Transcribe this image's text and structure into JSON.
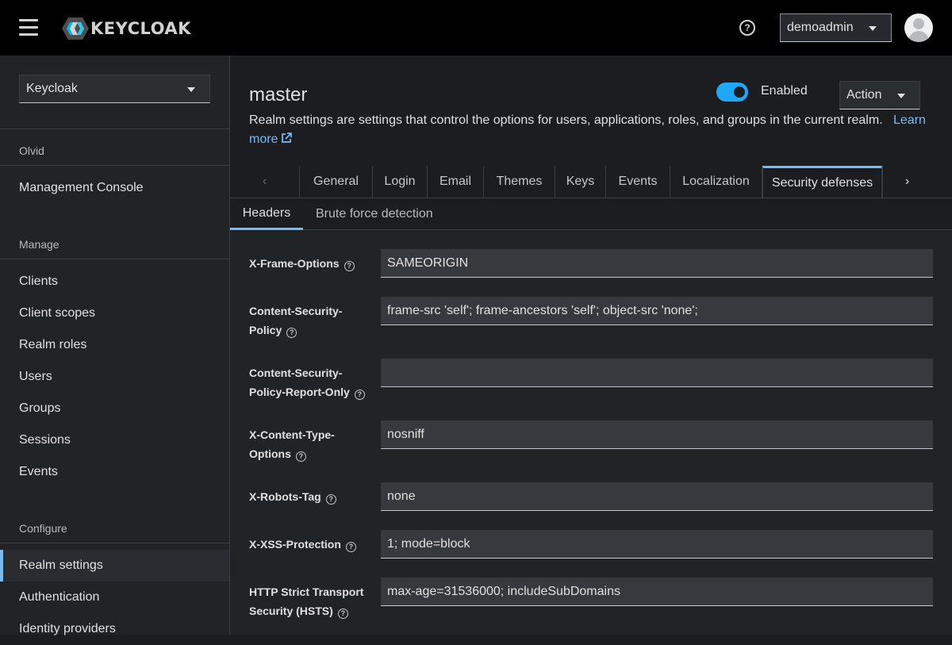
{
  "masthead": {
    "logo_text": "KEYCLOAK",
    "user_name": "demoadmin"
  },
  "sidebar": {
    "realm": "Keycloak",
    "sections": {
      "olvid": "Olvid",
      "manage": "Manage",
      "configure": "Configure"
    },
    "console_item": "Management Console",
    "manage_items": [
      "Clients",
      "Client scopes",
      "Realm roles",
      "Users",
      "Groups",
      "Sessions",
      "Events"
    ],
    "configure_items": [
      "Realm settings",
      "Authentication",
      "Identity providers"
    ]
  },
  "header": {
    "title": "master",
    "toggle_label": "Enabled",
    "toggle_on": true,
    "action_label": "Action",
    "description": "Realm settings are settings that control the options for users, applications, roles, and groups in the current realm.",
    "learn_more": "Learn more"
  },
  "tabs": [
    "General",
    "Login",
    "Email",
    "Themes",
    "Keys",
    "Events",
    "Localization",
    "Security defenses"
  ],
  "active_tab": "Security defenses",
  "subtabs": [
    "Headers",
    "Brute force detection"
  ],
  "active_subtab": "Headers",
  "form": {
    "xfo_label": "X-Frame-Options",
    "xfo_value": "SAMEORIGIN",
    "csp_label": "Content-Security-Policy",
    "csp_value": "frame-src 'self'; frame-ancestors 'self'; object-src 'none';",
    "cspro_label": "Content-Security-Policy-Report-Only",
    "cspro_value": "",
    "xcto_label": "X-Content-Type-Options",
    "xcto_value": "nosniff",
    "xrt_label": "X-Robots-Tag",
    "xrt_value": "none",
    "xxss_label": "X-XSS-Protection",
    "xxss_value": "1; mode=block",
    "hsts_label": "HTTP Strict Transport Security (HSTS)",
    "hsts_value": "max-age=31536000; includeSubDomains"
  },
  "colors": {
    "accent": "#73bcf7",
    "toggle": "#1fa7f8",
    "masthead": "#000000"
  },
  "icons": [
    "hamburger-icon",
    "keycloak-logo-icon",
    "help-icon",
    "avatar-icon",
    "external-link-icon",
    "chevron-left-icon",
    "chevron-right-icon",
    "question-circle-icon"
  ]
}
